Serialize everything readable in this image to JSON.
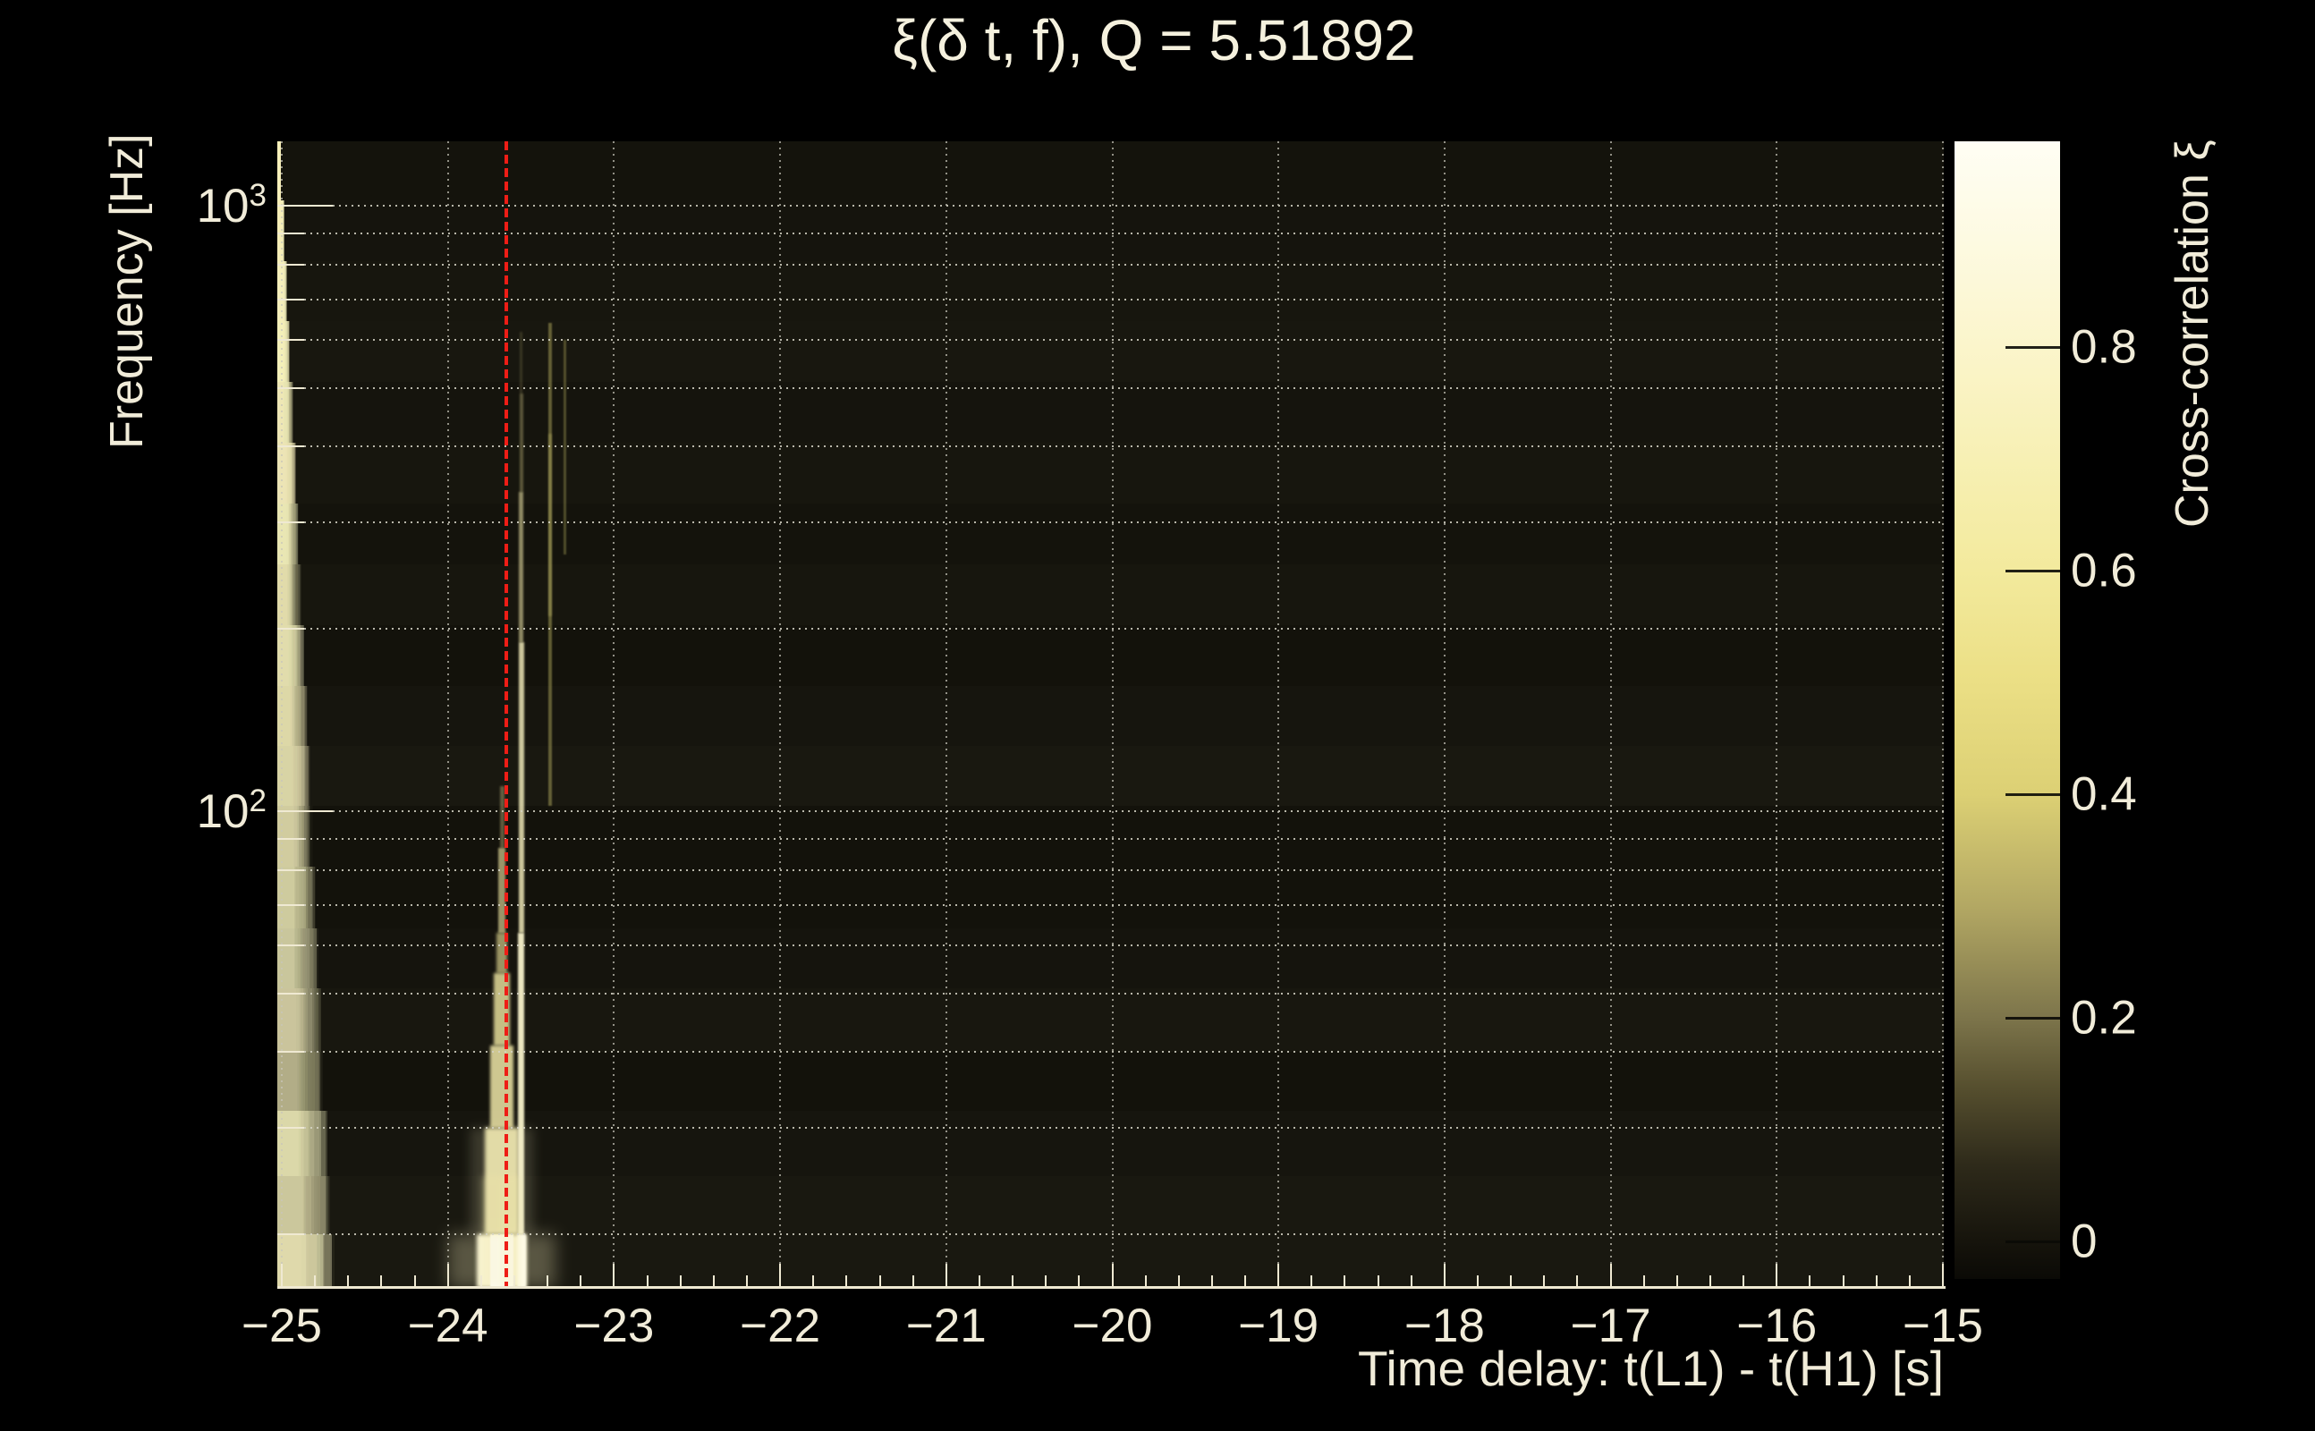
{
  "title": "ξ(δ t, f), Q = 5.51892",
  "colors": {
    "background": "#000000",
    "text": "#f1ecd9",
    "axis": "#efe9d2",
    "marker_red": "#ee1d16",
    "heatmap_base": "#100f09",
    "grid_dots": "#d6d4c6"
  },
  "chart_data": {
    "type": "heatmap",
    "title": "ξ(δ t, f), Q = 5.51892",
    "q_value": 5.51892,
    "xlabel": "Time delay: t(L1) - t(H1) [s]",
    "ylabel": "Frequency [Hz]",
    "x_range": [
      -25,
      -15
    ],
    "x_minor_step": 0.2,
    "x_ticks": [
      {
        "v": -25,
        "label": "−25"
      },
      {
        "v": -24,
        "label": "−24"
      },
      {
        "v": -23,
        "label": "−23"
      },
      {
        "v": -22,
        "label": "−22"
      },
      {
        "v": -21,
        "label": "−21"
      },
      {
        "v": -20,
        "label": "−20"
      },
      {
        "v": -19,
        "label": "−19"
      },
      {
        "v": -18,
        "label": "−18"
      },
      {
        "v": -17,
        "label": "−17"
      },
      {
        "v": -16,
        "label": "−16"
      },
      {
        "v": -15,
        "label": "−15"
      }
    ],
    "y_scale": "log",
    "y_range_hz": [
      16,
      1280
    ],
    "y_ticks": [
      {
        "hz": 1000,
        "base": "10",
        "exp": "3"
      },
      {
        "hz": 100,
        "base": "10",
        "exp": "2"
      }
    ],
    "y_gridline_freqs_hz": [
      1000,
      900,
      800,
      700,
      600,
      500,
      400,
      300,
      200,
      100,
      90,
      80,
      70,
      60,
      50,
      40,
      30,
      20
    ],
    "grid": "dotted minor and major gridlines, ROOT style",
    "legend_position": "right colorbar",
    "colorbar": {
      "label": "Cross-correlation ξ",
      "range": [
        -0.034,
        0.984
      ],
      "ticks": [
        {
          "v": 0.8,
          "label": "0.8"
        },
        {
          "v": 0.6,
          "label": "0.6"
        },
        {
          "v": 0.4,
          "label": "0.4"
        },
        {
          "v": 0.2,
          "label": "0.2"
        },
        {
          "v": 0.0,
          "label": "0"
        }
      ],
      "gradient": [
        [
          "0%",
          "#fffef4"
        ],
        [
          "9%",
          "#fdfae1"
        ],
        [
          "18.1%",
          "#fbf5cb"
        ],
        [
          "28%",
          "#f7f0b4"
        ],
        [
          "37.7%",
          "#f3ea9d"
        ],
        [
          "47.5%",
          "#ebdf85"
        ],
        [
          "57.4%",
          "#dcd074"
        ],
        [
          "67.4%",
          "#b2a763"
        ],
        [
          "77%",
          "#7d754b"
        ],
        [
          "83%",
          "#57502f"
        ],
        [
          "90%",
          "#2e2a1a"
        ],
        [
          "96.7%",
          "#16140c"
        ],
        [
          "100%",
          "#0b0a06"
        ]
      ]
    },
    "marker_line": {
      "delta_t_s": -23.65,
      "style": "red dashed vertical line"
    },
    "summary": "Cross-correlation is near 0 everywhere except a bright vertical ridge at time delay ≈ −23.66 s reaching ξ ≈ 0.98 below ~60 Hz, with a narrow core extending to ~500 Hz and faint companions near −23.56, −23.39 and −23.30 s.",
    "features": [
      {
        "t": -23.675,
        "f_hi": 20,
        "f_lo": 16,
        "w": 120,
        "color": "#fff6c4",
        "alpha": 0.28,
        "blur": 9
      },
      {
        "t": -23.675,
        "f_hi": 20,
        "f_lo": 16,
        "w": 56,
        "color": "#fffad8",
        "alpha": 0.97,
        "blur": 2
      },
      {
        "t": -23.675,
        "f_hi": 20,
        "f_lo": 16,
        "w": 26,
        "color": "#fffef6",
        "alpha": 1.0,
        "blur": 0.5
      },
      {
        "t": -23.675,
        "f_hi": 30,
        "f_lo": 20,
        "w": 70,
        "color": "#fdf6c8",
        "alpha": 0.16,
        "blur": 6
      },
      {
        "t": -23.675,
        "f_hi": 30,
        "f_lo": 20,
        "w": 38,
        "color": "#faf2b8",
        "alpha": 0.88,
        "blur": 2
      },
      {
        "t": -23.675,
        "f_hi": 41,
        "f_lo": 30,
        "w": 26,
        "color": "#f8efae",
        "alpha": 0.82,
        "blur": 1.5
      },
      {
        "t": -23.675,
        "f_hi": 54,
        "f_lo": 41,
        "w": 18,
        "color": "#f6eda6",
        "alpha": 0.78,
        "blur": 1.5
      },
      {
        "t": -23.675,
        "f_hi": 63,
        "f_lo": 54,
        "w": 12,
        "color": "#f3e99c",
        "alpha": 0.6,
        "blur": 1.5
      },
      {
        "t": -23.675,
        "f_hi": 87,
        "f_lo": 63,
        "w": 8,
        "color": "#f5eca6",
        "alpha": 0.6,
        "blur": 1
      },
      {
        "t": -23.675,
        "f_hi": 110,
        "f_lo": 87,
        "w": 5,
        "color": "#eee29a",
        "alpha": 0.35,
        "blur": 1
      },
      {
        "t": -23.557,
        "f_hi": 20,
        "f_lo": 16,
        "w": 10,
        "color": "#fffce8",
        "alpha": 0.95,
        "blur": 1
      },
      {
        "t": -23.557,
        "f_hi": 63,
        "f_lo": 20,
        "w": 7,
        "color": "#fdf8d0",
        "alpha": 0.92,
        "blur": 1
      },
      {
        "t": -23.557,
        "f_hi": 190,
        "f_lo": 63,
        "w": 6,
        "color": "#faf3c0",
        "alpha": 0.8,
        "blur": 1
      },
      {
        "t": -23.557,
        "f_hi": 337,
        "f_lo": 190,
        "w": 5,
        "color": "#f5ecac",
        "alpha": 0.55,
        "blur": 1
      },
      {
        "t": -23.557,
        "f_hi": 490,
        "f_lo": 337,
        "w": 4,
        "color": "#eee29a",
        "alpha": 0.32,
        "blur": 1
      },
      {
        "t": -23.557,
        "f_hi": 620,
        "f_lo": 490,
        "w": 3,
        "color": "#e5d98c",
        "alpha": 0.16,
        "blur": 1
      },
      {
        "t": -23.385,
        "f_hi": 640,
        "f_lo": 102,
        "w": 3.5,
        "color": "#ded574",
        "alpha": 0.38,
        "blur": 0.8
      },
      {
        "t": -23.385,
        "f_hi": 420,
        "f_lo": 210,
        "w": 4,
        "color": "#e2d97c",
        "alpha": 0.25,
        "blur": 1
      },
      {
        "t": -23.298,
        "f_hi": 600,
        "f_lo": 265,
        "w": 3,
        "color": "#d9d070",
        "alpha": 0.3,
        "blur": 0.8
      },
      {
        "t": -23.73,
        "f_hi": 25,
        "f_lo": 16,
        "w": 26,
        "color": "#efe6a8",
        "alpha": 0.25,
        "blur": 4
      },
      {
        "t": -23.62,
        "f_hi": 25,
        "f_lo": 16,
        "w": 20,
        "color": "#efe6a8",
        "alpha": 0.3,
        "blur": 3
      }
    ],
    "tile_row_edges_hz": [
      1280,
      1020,
      810,
      645,
      512,
      406,
      322,
      256,
      203,
      161,
      128,
      102,
      81,
      64,
      51,
      40,
      32,
      25,
      20,
      16
    ],
    "texture": {
      "seed": 9
    }
  }
}
